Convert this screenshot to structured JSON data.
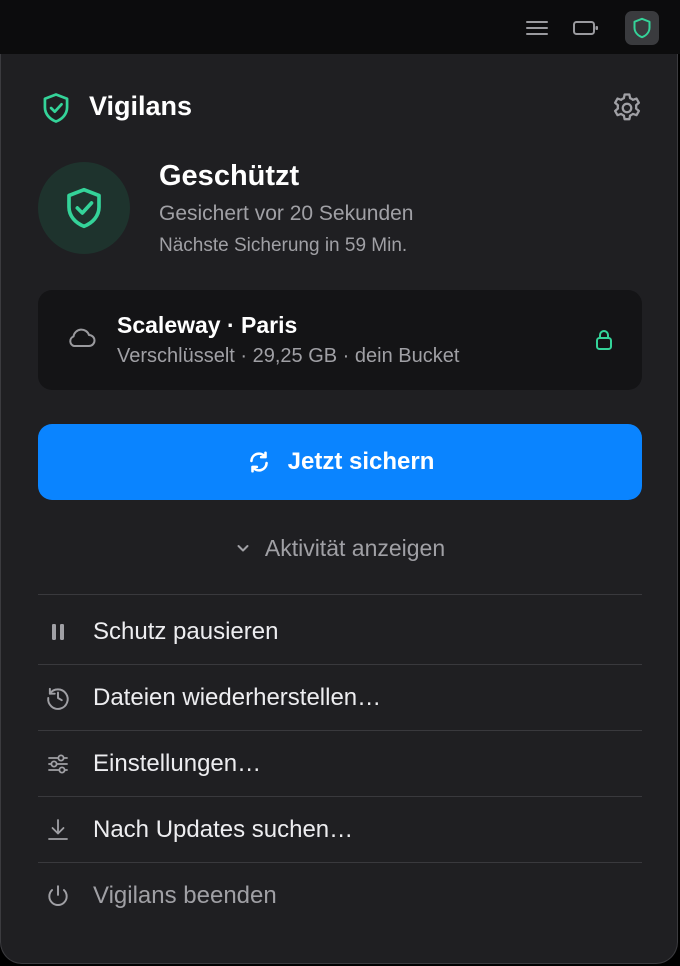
{
  "menubar": {
    "icons": [
      "menu-icon",
      "battery-icon",
      "vigilans-tray-icon"
    ]
  },
  "header": {
    "app_name": "Vigilans",
    "logo_icon": "shield-check-icon",
    "settings_icon": "gear-icon"
  },
  "status": {
    "title": "Geschützt",
    "last_backup": "Gesichert vor 20 Sekunden",
    "next_backup": "Nächste Sicherung in 59 Min.",
    "icon": "shield-check-icon"
  },
  "storage": {
    "provider": "Scaleway · Paris",
    "details": "Verschlüsselt · 29,25 GB · dein Bucket",
    "icon": "cloud-icon",
    "lock_icon": "lock-icon"
  },
  "backup_button": {
    "label": "Jetzt sichern",
    "icon": "sync-icon"
  },
  "activity": {
    "label": "Aktivität anzeigen",
    "icon": "chevron-down-icon"
  },
  "menu": {
    "items": [
      {
        "label": "Schutz pausieren",
        "icon": "pause-icon"
      },
      {
        "label": "Dateien wiederherstellen…",
        "icon": "clock-history-icon"
      },
      {
        "label": "Einstellungen…",
        "icon": "sliders-icon"
      },
      {
        "label": "Nach Updates suchen…",
        "icon": "download-icon"
      },
      {
        "label": "Vigilans beenden",
        "icon": "power-icon"
      }
    ]
  },
  "colors": {
    "accent": "#0a84ff",
    "success": "#34d399",
    "panel_bg": "#1f1f22",
    "card_bg": "#141416",
    "text_secondary": "#a0a0a5"
  }
}
